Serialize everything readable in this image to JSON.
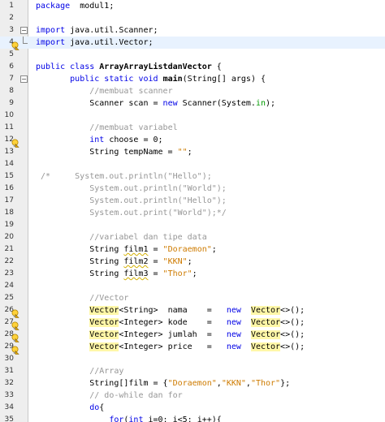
{
  "lines": [
    {
      "n": "1",
      "icon": "",
      "fold": "",
      "segs": [
        [
          "kw",
          "package"
        ],
        [
          "",
          "  modul1;"
        ]
      ]
    },
    {
      "n": "2",
      "icon": "",
      "fold": "",
      "segs": []
    },
    {
      "n": "3",
      "icon": "",
      "fold": "minus",
      "segs": [
        [
          "kw",
          "import"
        ],
        [
          "",
          " java.util.Scanner;"
        ]
      ]
    },
    {
      "n": "4",
      "icon": "warning-bulb",
      "fold": "end",
      "hl": true,
      "segs": [
        [
          "kw",
          "import"
        ],
        [
          "",
          " java.util.Vector;"
        ]
      ]
    },
    {
      "n": "5",
      "icon": "",
      "fold": "",
      "segs": []
    },
    {
      "n": "6",
      "icon": "",
      "fold": "",
      "segs": [
        [
          "kw",
          "public class"
        ],
        [
          "",
          " "
        ],
        [
          "bold",
          "ArrayArrayListdanVector"
        ],
        [
          "",
          " {"
        ]
      ]
    },
    {
      "n": "7",
      "icon": "",
      "fold": "minus",
      "segs": [
        [
          "",
          "       "
        ],
        [
          "kw",
          "public static void"
        ],
        [
          "",
          " "
        ],
        [
          "bold",
          "main"
        ],
        [
          "",
          "(String[] args) {"
        ]
      ]
    },
    {
      "n": "8",
      "icon": "",
      "fold": "",
      "segs": [
        [
          "",
          "           "
        ],
        [
          "cm",
          "//membuat scanner"
        ]
      ]
    },
    {
      "n": "9",
      "icon": "",
      "fold": "",
      "segs": [
        [
          "",
          "           Scanner scan = "
        ],
        [
          "kw",
          "new"
        ],
        [
          "",
          " Scanner(System."
        ],
        [
          "field",
          "in"
        ],
        [
          "",
          ");"
        ]
      ]
    },
    {
      "n": "10",
      "icon": "",
      "fold": "",
      "segs": []
    },
    {
      "n": "11",
      "icon": "",
      "fold": "",
      "segs": [
        [
          "",
          "           "
        ],
        [
          "cm",
          "//membuat variabel"
        ]
      ]
    },
    {
      "n": "12",
      "icon": "warning-bulb",
      "fold": "",
      "segs": [
        [
          "",
          "           "
        ],
        [
          "kw",
          "int"
        ],
        [
          "",
          " choose = 0;"
        ]
      ]
    },
    {
      "n": "13",
      "icon": "",
      "fold": "",
      "segs": [
        [
          "",
          "           String tempName = "
        ],
        [
          "st",
          "\"\""
        ],
        [
          "",
          ";"
        ]
      ]
    },
    {
      "n": "14",
      "icon": "",
      "fold": "",
      "segs": []
    },
    {
      "n": "15",
      "icon": "",
      "fold": "",
      "segs": [
        [
          "cm",
          " /*     System.out.println(\"Hello\");"
        ]
      ]
    },
    {
      "n": "16",
      "icon": "",
      "fold": "",
      "segs": [
        [
          "cm",
          "           System.out.println(\"World\");"
        ]
      ]
    },
    {
      "n": "17",
      "icon": "",
      "fold": "",
      "segs": [
        [
          "cm",
          "           System.out.println(\"Hello\");"
        ]
      ]
    },
    {
      "n": "18",
      "icon": "",
      "fold": "",
      "segs": [
        [
          "cm",
          "           System.out.print(\"World\");*/"
        ]
      ]
    },
    {
      "n": "19",
      "icon": "",
      "fold": "",
      "segs": []
    },
    {
      "n": "20",
      "icon": "",
      "fold": "",
      "segs": [
        [
          "",
          "           "
        ],
        [
          "cm",
          "//variabel dan tipe data"
        ]
      ]
    },
    {
      "n": "21",
      "icon": "",
      "fold": "",
      "segs": [
        [
          "",
          "           String "
        ],
        [
          "warn",
          "film1"
        ],
        [
          "",
          " = "
        ],
        [
          "st",
          "\"Doraemon\""
        ],
        [
          "",
          ";"
        ]
      ]
    },
    {
      "n": "22",
      "icon": "",
      "fold": "",
      "segs": [
        [
          "",
          "           String "
        ],
        [
          "warn",
          "film2"
        ],
        [
          "",
          " = "
        ],
        [
          "st",
          "\"KKN\""
        ],
        [
          "",
          ";"
        ]
      ]
    },
    {
      "n": "23",
      "icon": "",
      "fold": "",
      "segs": [
        [
          "",
          "           String "
        ],
        [
          "warn",
          "film3"
        ],
        [
          "",
          " = "
        ],
        [
          "st",
          "\"Thor\""
        ],
        [
          "",
          ";"
        ]
      ]
    },
    {
      "n": "24",
      "icon": "",
      "fold": "",
      "segs": []
    },
    {
      "n": "25",
      "icon": "",
      "fold": "",
      "segs": [
        [
          "",
          "           "
        ],
        [
          "cm",
          "//Vector"
        ]
      ]
    },
    {
      "n": "26",
      "icon": "warning-bulb",
      "fold": "",
      "segs": [
        [
          "",
          "           "
        ],
        [
          "cls",
          "Vector"
        ],
        [
          "",
          "<String>  nama    =   "
        ],
        [
          "kw",
          "new"
        ],
        [
          "",
          "  "
        ],
        [
          "cls",
          "Vector"
        ],
        [
          "",
          "<>();"
        ]
      ]
    },
    {
      "n": "27",
      "icon": "warning-bulb",
      "fold": "",
      "segs": [
        [
          "",
          "           "
        ],
        [
          "cls",
          "Vector"
        ],
        [
          "",
          "<Integer> kode    =   "
        ],
        [
          "kw",
          "new"
        ],
        [
          "",
          "  "
        ],
        [
          "cls",
          "Vector"
        ],
        [
          "",
          "<>();"
        ]
      ]
    },
    {
      "n": "28",
      "icon": "warning-bulb",
      "fold": "",
      "segs": [
        [
          "",
          "           "
        ],
        [
          "cls",
          "Vector"
        ],
        [
          "",
          "<Integer> jumlah  =   "
        ],
        [
          "kw",
          "new"
        ],
        [
          "",
          "  "
        ],
        [
          "cls",
          "Vector"
        ],
        [
          "",
          "<>();"
        ]
      ]
    },
    {
      "n": "29",
      "icon": "warning-bulb",
      "fold": "",
      "segs": [
        [
          "",
          "           "
        ],
        [
          "cls",
          "Vector"
        ],
        [
          "",
          "<Integer> price   =   "
        ],
        [
          "kw",
          "new"
        ],
        [
          "",
          "  "
        ],
        [
          "cls",
          "Vector"
        ],
        [
          "",
          "<>();"
        ]
      ]
    },
    {
      "n": "30",
      "icon": "",
      "fold": "",
      "segs": []
    },
    {
      "n": "31",
      "icon": "",
      "fold": "",
      "segs": [
        [
          "",
          "           "
        ],
        [
          "cm",
          "//Array"
        ]
      ]
    },
    {
      "n": "32",
      "icon": "",
      "fold": "",
      "segs": [
        [
          "",
          "           String[]film = {"
        ],
        [
          "st",
          "\"Doraemon\""
        ],
        [
          "",
          ","
        ],
        [
          "st",
          "\"KKN\""
        ],
        [
          "",
          ","
        ],
        [
          "st",
          "\"Thor\""
        ],
        [
          "",
          "};"
        ]
      ]
    },
    {
      "n": "33",
      "icon": "",
      "fold": "",
      "segs": [
        [
          "",
          "           "
        ],
        [
          "cm",
          "// do-while dan for"
        ]
      ]
    },
    {
      "n": "34",
      "icon": "",
      "fold": "",
      "segs": [
        [
          "",
          "           "
        ],
        [
          "kw",
          "do"
        ],
        [
          "",
          "{"
        ]
      ]
    },
    {
      "n": "35",
      "icon": "",
      "fold": "",
      "segs": [
        [
          "",
          "               "
        ],
        [
          "kw",
          "for"
        ],
        [
          "",
          "("
        ],
        [
          "kw",
          "int"
        ],
        [
          "",
          " i=0; i<5; i++){"
        ]
      ]
    }
  ]
}
